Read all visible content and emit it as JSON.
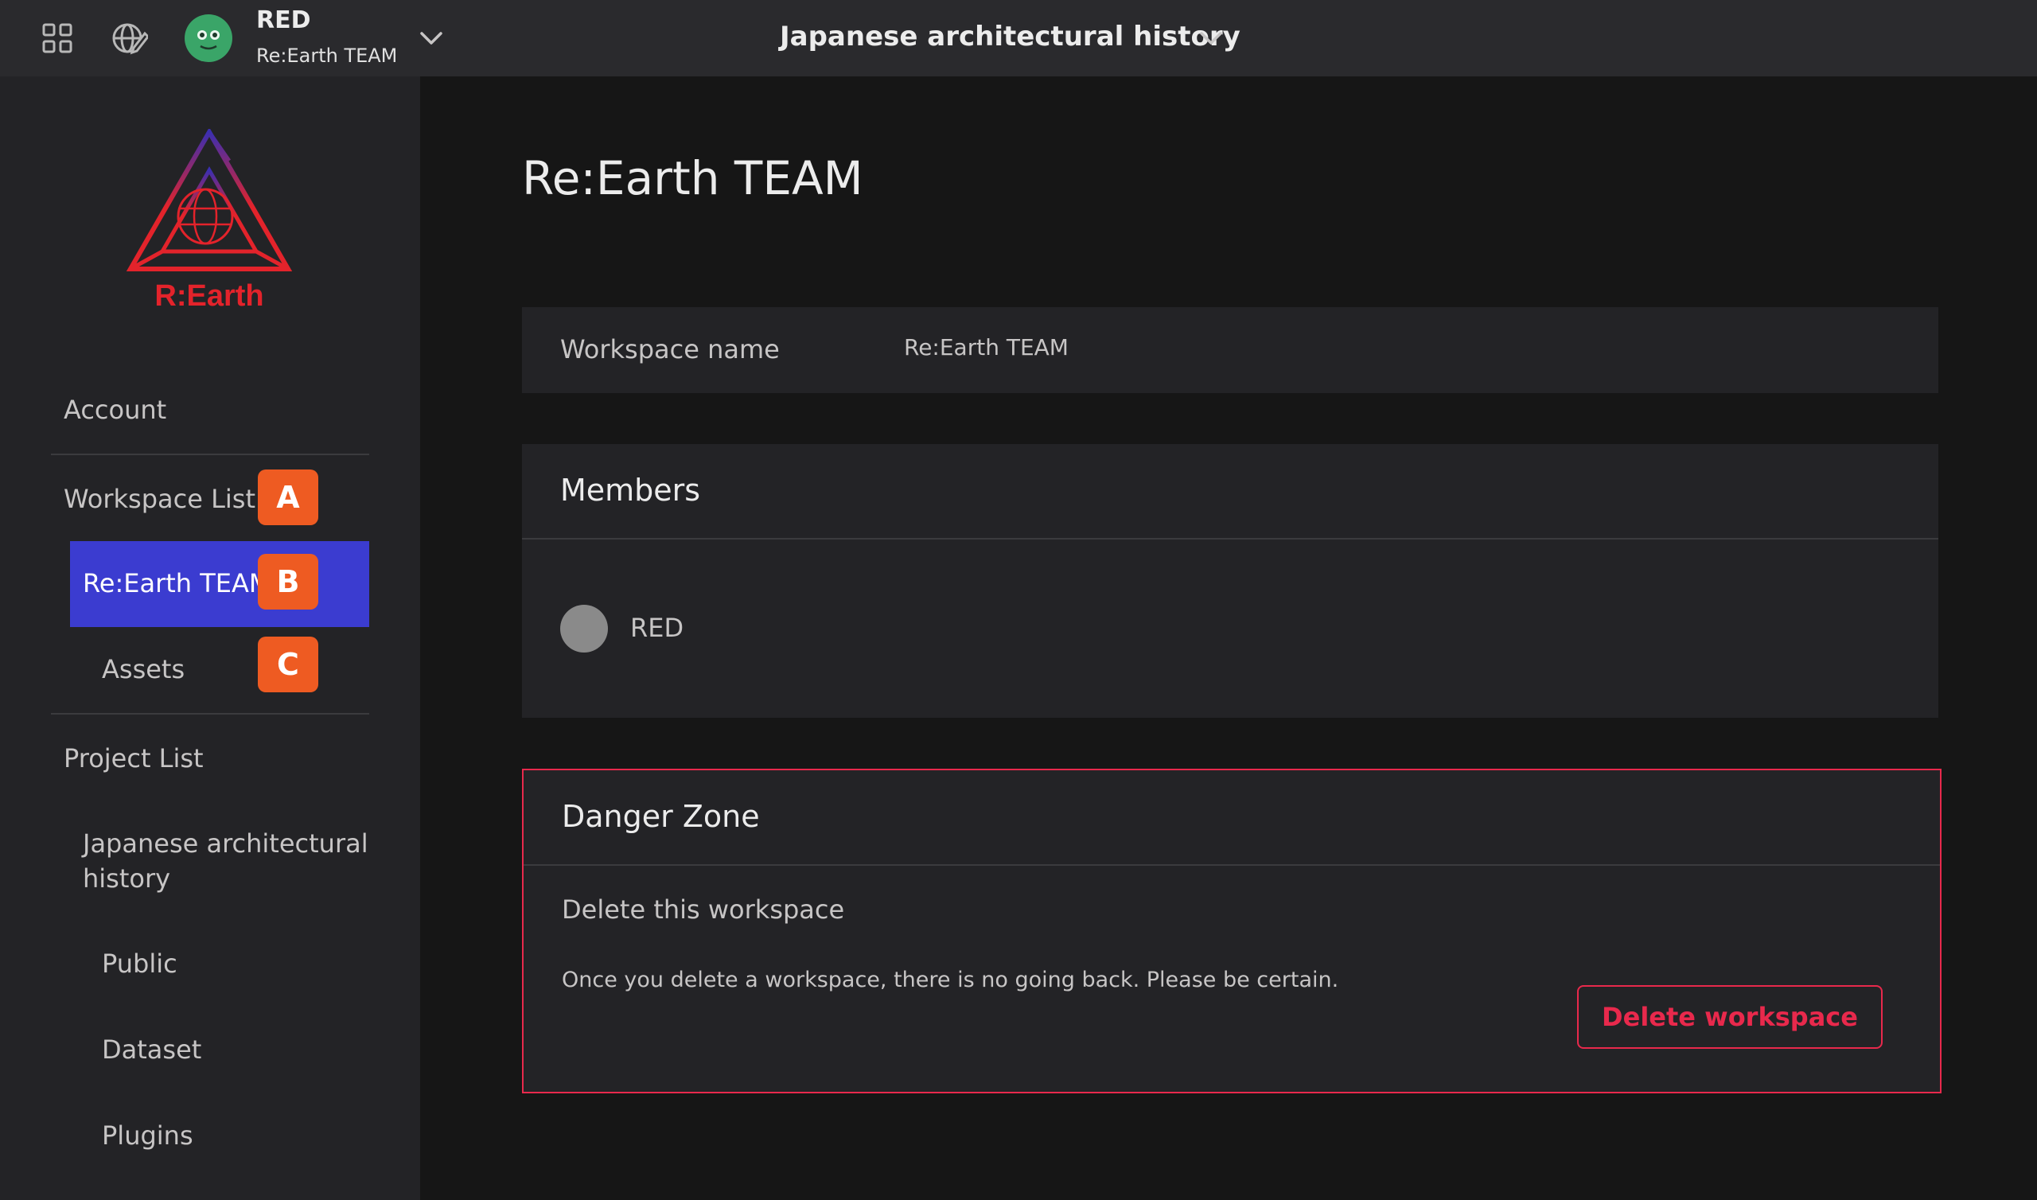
{
  "header": {
    "user_name": "RED",
    "team_name": "Re:Earth TEAM",
    "project_title": "Japanese architectural history",
    "icons": [
      "apps-grid-icon",
      "globe-edit-icon",
      "chevron-down-icon"
    ]
  },
  "sidebar": {
    "logo_text": "R:Earth",
    "account": "Account",
    "workspace_list": "Workspace List",
    "workspace_active": "Re:Earth TEAM",
    "assets": "Assets",
    "project_list": "Project List",
    "project_name": "Japanese architectural history",
    "public": "Public",
    "dataset": "Dataset",
    "plugins": "Plugins"
  },
  "badges": {
    "a": "A",
    "b": "B",
    "c": "C"
  },
  "main": {
    "title": "Re:Earth TEAM",
    "workspace_name_label": "Workspace name",
    "workspace_name_value": "Re:Earth TEAM",
    "members_title": "Members",
    "members": [
      {
        "name": "RED"
      }
    ],
    "danger_title": "Danger Zone",
    "danger_subtitle": "Delete this workspace",
    "danger_description": "Once you delete a workspace, there is no going back. Please be certain.",
    "delete_button": "Delete workspace"
  },
  "colors": {
    "active_nav": "#3b3cd0",
    "badge": "#ee5b22",
    "danger": "#e8294c",
    "logo_red": "#e3232b"
  }
}
